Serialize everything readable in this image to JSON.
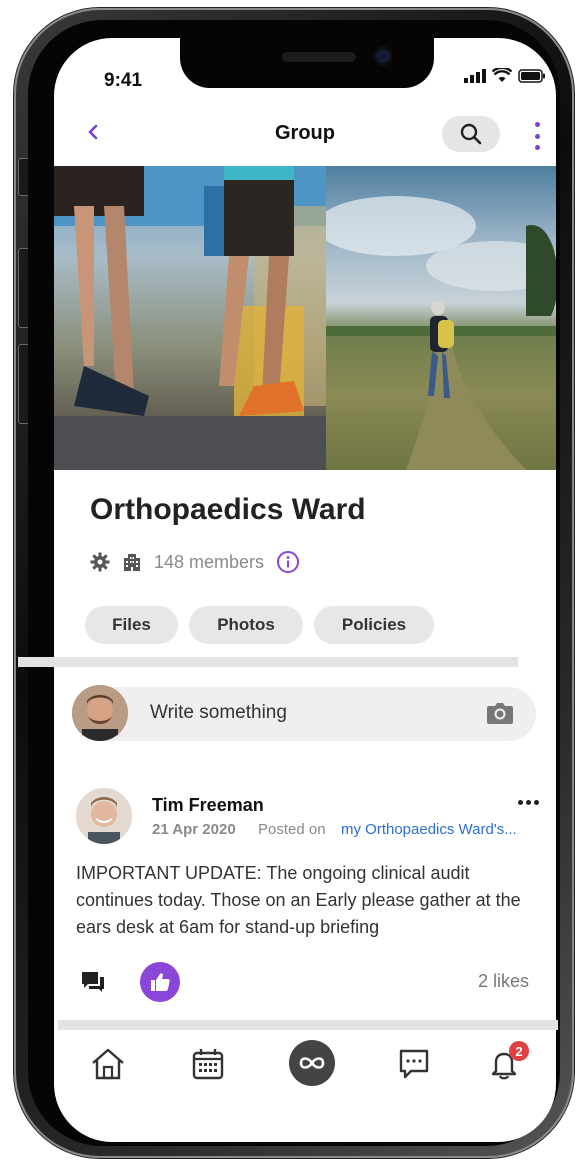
{
  "status_bar": {
    "time": "9:41"
  },
  "nav": {
    "title": "Group"
  },
  "group": {
    "name": "Orthopaedics Ward",
    "members": "148 members",
    "chips": [
      {
        "label": "Files"
      },
      {
        "label": "Photos"
      },
      {
        "label": "Policies"
      }
    ]
  },
  "composer": {
    "placeholder": "Write something"
  },
  "post": {
    "author": "Tim Freeman",
    "date": "21 Apr 2020",
    "posted_on_prefix": "Posted on",
    "posted_on_link": "my Orthopaedics Ward's...",
    "body": "IMPORTANT UPDATE: The ongoing clinical audit continues today. Those on an Early please gather at the ears desk at 6am for stand-up briefing",
    "likes": "2 likes"
  },
  "tabbar": {
    "tabs": [
      {
        "icon": "home-icon"
      },
      {
        "icon": "calendar-icon"
      },
      {
        "icon": "infinity-icon"
      },
      {
        "icon": "chat-icon"
      },
      {
        "icon": "bell-icon"
      }
    ],
    "notification_count": "2"
  },
  "colors": {
    "accent": "#8b45d8",
    "link": "#2d6fd0",
    "badge": "#e0403f"
  }
}
